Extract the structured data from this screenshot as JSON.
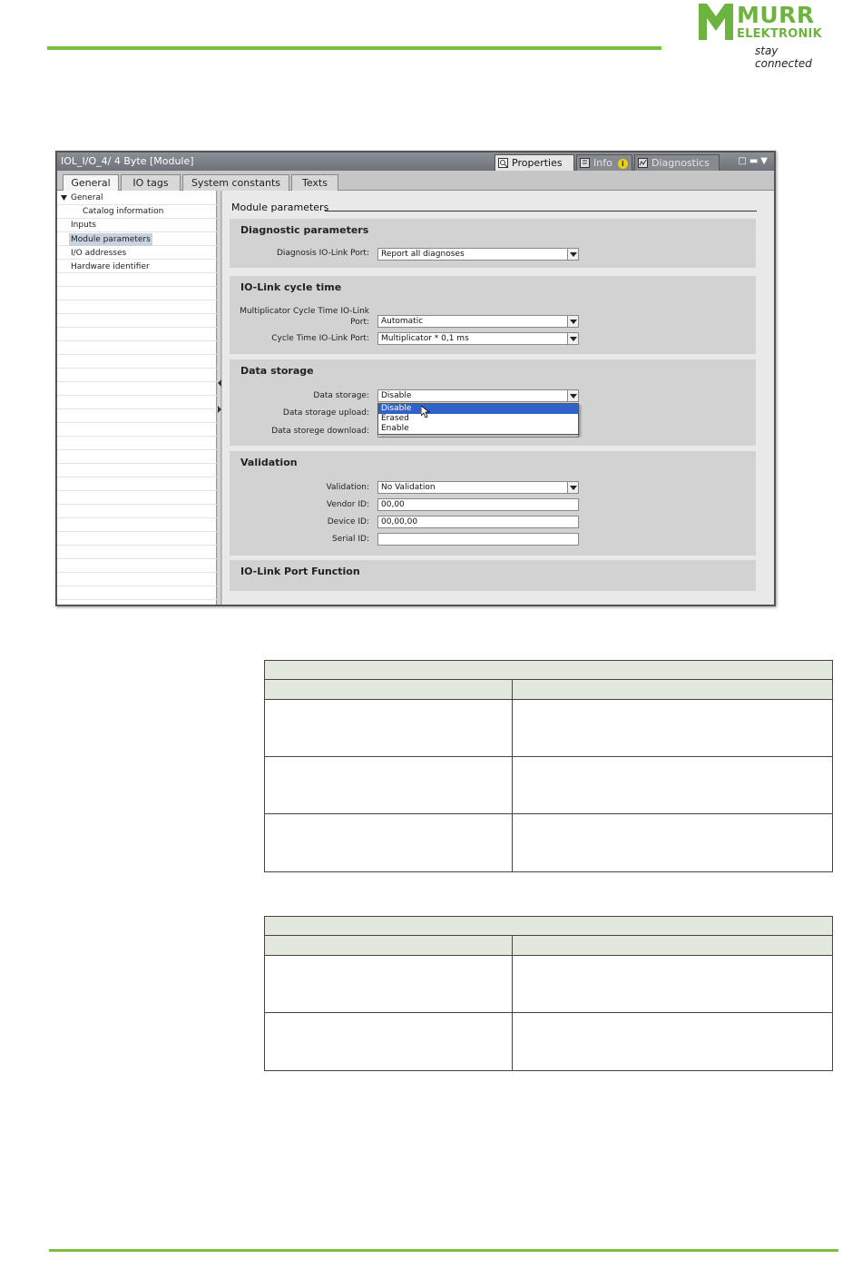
{
  "logo": {
    "word1": "MURR",
    "word2": "ELEKTRONIK",
    "tagline": "stay connected",
    "brand_color": "#7ac043"
  },
  "window": {
    "title": "IOL_I/O_4/ 4 Byte [Module]",
    "right_tabs": {
      "properties": "Properties",
      "info": "Info",
      "diagnostics": "Diagnostics"
    },
    "tabs": [
      "General",
      "IO tags",
      "System constants",
      "Texts"
    ],
    "active_tab": "General",
    "nav": {
      "items": [
        "General",
        "Catalog information",
        "Inputs",
        "Module parameters",
        "I/O addresses",
        "Hardware identifier"
      ],
      "selected": "Module parameters"
    },
    "section_heading": "Module parameters",
    "groups": {
      "diagnostic": {
        "title": "Diagnostic parameters",
        "fields": [
          {
            "label": "Diagnosis IO-Link Port:",
            "value": "Report all diagnoses"
          }
        ]
      },
      "cycle": {
        "title": "IO-Link cycle time",
        "fields": [
          {
            "label_line1": "Multiplicator Cycle Time IO-Link",
            "label_line2": "Port:",
            "value": "Automatic"
          },
          {
            "label": "Cycle Time IO-Link Port:",
            "value": "Multiplicator * 0,1 ms"
          }
        ]
      },
      "storage": {
        "title": "Data storage",
        "fields": [
          {
            "label": "Data storage:",
            "value": "Disable"
          },
          {
            "label": "Data storage upload:"
          },
          {
            "label": "Data storege download:"
          }
        ],
        "dropdown_options": [
          "Disable",
          "Erased",
          "Enable"
        ],
        "highlighted_option": "Disable"
      },
      "validation": {
        "title": "Validation",
        "fields": [
          {
            "label": "Validation:",
            "value": "No Validation"
          },
          {
            "label": "Vendor ID:",
            "value": "00,00"
          },
          {
            "label": "Device ID:",
            "value": "00,00,00"
          },
          {
            "label": "Serial ID:",
            "value": ""
          }
        ]
      },
      "port_function": {
        "title": "IO-Link Port Function"
      }
    }
  },
  "tables": [
    {
      "rows": 3
    },
    {
      "rows": 2
    }
  ]
}
